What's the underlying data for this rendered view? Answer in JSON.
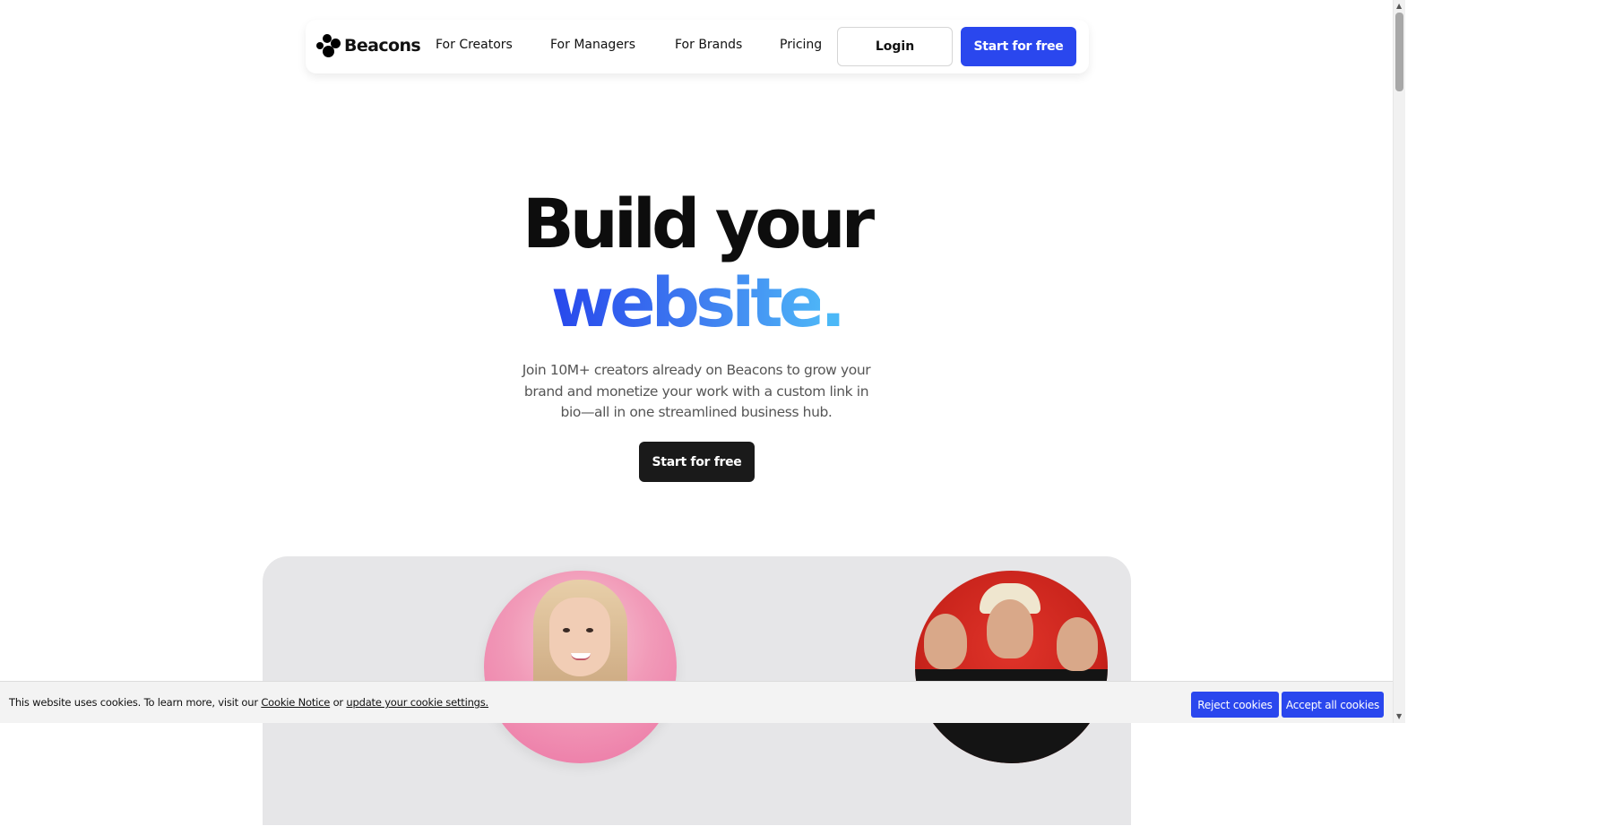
{
  "nav": {
    "brand": "Beacons",
    "links": [
      "For Creators",
      "For Managers",
      "For Brands",
      "Pricing"
    ],
    "login_label": "Login",
    "start_label": "Start for free"
  },
  "hero": {
    "line1": "Build your",
    "line2_word": "website",
    "line2_dot": ".",
    "subtitle": "Join 10M+ creators already on Beacons to grow your brand and monetize your work with a custom link in bio—all in one streamlined business hub.",
    "cta_label": "Start for free"
  },
  "cookie": {
    "text_prefix": "This website uses cookies. To learn more, visit our ",
    "notice_link": "Cookie Notice",
    "text_mid": " or ",
    "settings_link": "update your cookie settings.",
    "reject_label": "Reject cookies",
    "accept_label": "Accept all cookies"
  },
  "colors": {
    "accent": "#2a47ee",
    "gradient_start": "#2747ec",
    "gradient_end": "#4db4f7",
    "dark_button": "#1a1a1a"
  }
}
